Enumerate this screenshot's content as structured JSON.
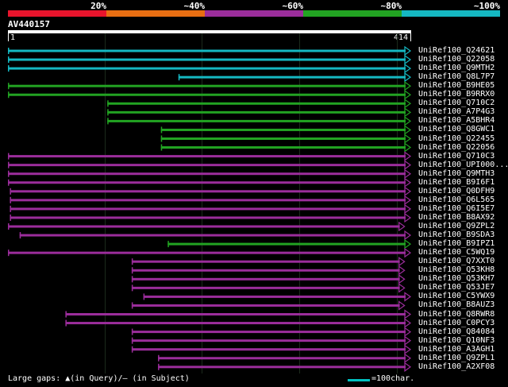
{
  "color_key": {
    "labels": [
      "20%",
      "~40%",
      "~60%",
      "~80%",
      "~100%"
    ],
    "colors": [
      "#e8142c",
      "#e86e12",
      "#9b2d9b",
      "#22a322",
      "#15b8c2"
    ]
  },
  "query": {
    "id": "AV440157",
    "start_label": "1",
    "end_label": "414",
    "length": 414
  },
  "hits": [
    {
      "label": "UniRef100_Q24621",
      "color": "#15b8c2",
      "start": 1,
      "end": 414,
      "arrow": true
    },
    {
      "label": "UniRef100_Q22058",
      "color": "#15b8c2",
      "start": 1,
      "end": 414,
      "arrow": true
    },
    {
      "label": "UniRef100_Q9MTH2",
      "color": "#15b8c2",
      "start": 1,
      "end": 414,
      "arrow": true
    },
    {
      "label": "UniRef100_Q8L7P7",
      "color": "#15b8c2",
      "start": 176,
      "end": 414,
      "arrow": true
    },
    {
      "label": "UniRef100_B9HE05",
      "color": "#22a322",
      "start": 1,
      "end": 414,
      "arrow": true
    },
    {
      "label": "UniRef100_B9RRX0",
      "color": "#22a322",
      "start": 1,
      "end": 414,
      "arrow": true
    },
    {
      "label": "UniRef100_Q710C2",
      "color": "#22a322",
      "start": 103,
      "end": 414,
      "arrow": true
    },
    {
      "label": "UniRef100_A7P4G3",
      "color": "#22a322",
      "start": 103,
      "end": 414,
      "arrow": true
    },
    {
      "label": "UniRef100_A5BHR4",
      "color": "#22a322",
      "start": 103,
      "end": 414,
      "arrow": true
    },
    {
      "label": "UniRef100_Q8GWC1",
      "color": "#22a322",
      "start": 158,
      "end": 414,
      "arrow": true
    },
    {
      "label": "UniRef100_Q22455",
      "color": "#22a322",
      "start": 158,
      "end": 414,
      "arrow": true
    },
    {
      "label": "UniRef100_Q22056",
      "color": "#22a322",
      "start": 158,
      "end": 414,
      "arrow": true
    },
    {
      "label": "UniRef100_Q710C3",
      "color": "#9b2d9b",
      "start": 1,
      "end": 414,
      "arrow": true
    },
    {
      "label": "UniRef100_UPI000...",
      "color": "#9b2d9b",
      "start": 1,
      "end": 414,
      "arrow": true
    },
    {
      "label": "UniRef100_Q9MTH3",
      "color": "#9b2d9b",
      "start": 1,
      "end": 414,
      "arrow": true
    },
    {
      "label": "UniRef100_B9I6F1",
      "color": "#9b2d9b",
      "start": 1,
      "end": 414,
      "arrow": true
    },
    {
      "label": "UniRef100_Q0DFH9",
      "color": "#9b2d9b",
      "start": 3,
      "end": 414,
      "arrow": true
    },
    {
      "label": "UniRef100_Q6L565",
      "color": "#9b2d9b",
      "start": 3,
      "end": 414,
      "arrow": true
    },
    {
      "label": "UniRef100_Q6I5E7",
      "color": "#9b2d9b",
      "start": 3,
      "end": 414,
      "arrow": true
    },
    {
      "label": "UniRef100_B8AX92",
      "color": "#9b2d9b",
      "start": 3,
      "end": 414,
      "arrow": true
    },
    {
      "label": "UniRef100_Q9ZPL2",
      "color": "#9b2d9b",
      "start": 1,
      "end": 408,
      "arrow": true
    },
    {
      "label": "UniRef100_B9SDA3",
      "color": "#9b2d9b",
      "start": 13,
      "end": 414,
      "arrow": true
    },
    {
      "label": "UniRef100_B9IPZ1",
      "color": "#22a322",
      "start": 165,
      "end": 414,
      "arrow": true
    },
    {
      "label": "UniRef100_C5WQ19",
      "color": "#9b2d9b",
      "start": 1,
      "end": 414,
      "arrow": true
    },
    {
      "label": "UniRef100_Q7XXT0",
      "color": "#9b2d9b",
      "start": 128,
      "end": 408,
      "arrow": true
    },
    {
      "label": "UniRef100_Q53KH8",
      "color": "#9b2d9b",
      "start": 128,
      "end": 408,
      "arrow": true
    },
    {
      "label": "UniRef100_Q53KH7",
      "color": "#9b2d9b",
      "start": 128,
      "end": 408,
      "arrow": true
    },
    {
      "label": "UniRef100_Q53JE7",
      "color": "#9b2d9b",
      "start": 128,
      "end": 408,
      "arrow": true
    },
    {
      "label": "UniRef100_C5YWX9",
      "color": "#9b2d9b",
      "start": 140,
      "end": 414,
      "arrow": true
    },
    {
      "label": "UniRef100_B8AUZ3",
      "color": "#9b2d9b",
      "start": 128,
      "end": 408,
      "arrow": true
    },
    {
      "label": "UniRef100_Q8RWR8",
      "color": "#9b2d9b",
      "start": 60,
      "end": 414,
      "arrow": true
    },
    {
      "label": "UniRef100_C0PCY3",
      "color": "#9b2d9b",
      "start": 60,
      "end": 414,
      "arrow": true
    },
    {
      "label": "UniRef100_Q84084",
      "color": "#9b2d9b",
      "start": 128,
      "end": 414,
      "arrow": true
    },
    {
      "label": "UniRef100_Q10NF3",
      "color": "#9b2d9b",
      "start": 128,
      "end": 414,
      "arrow": true
    },
    {
      "label": "UniRef100_A3AGH1",
      "color": "#9b2d9b",
      "start": 128,
      "end": 414,
      "arrow": true
    },
    {
      "label": "UniRef100_Q9ZPL1",
      "color": "#9b2d9b",
      "start": 155,
      "end": 414,
      "arrow": true
    },
    {
      "label": "UniRef100_A2XF08",
      "color": "#9b2d9b",
      "start": 155,
      "end": 414,
      "arrow": true
    }
  ],
  "footer": {
    "legend_text": "Large gaps: ▲(in Query)/– (in Subject)",
    "scale_text": "=100char."
  }
}
